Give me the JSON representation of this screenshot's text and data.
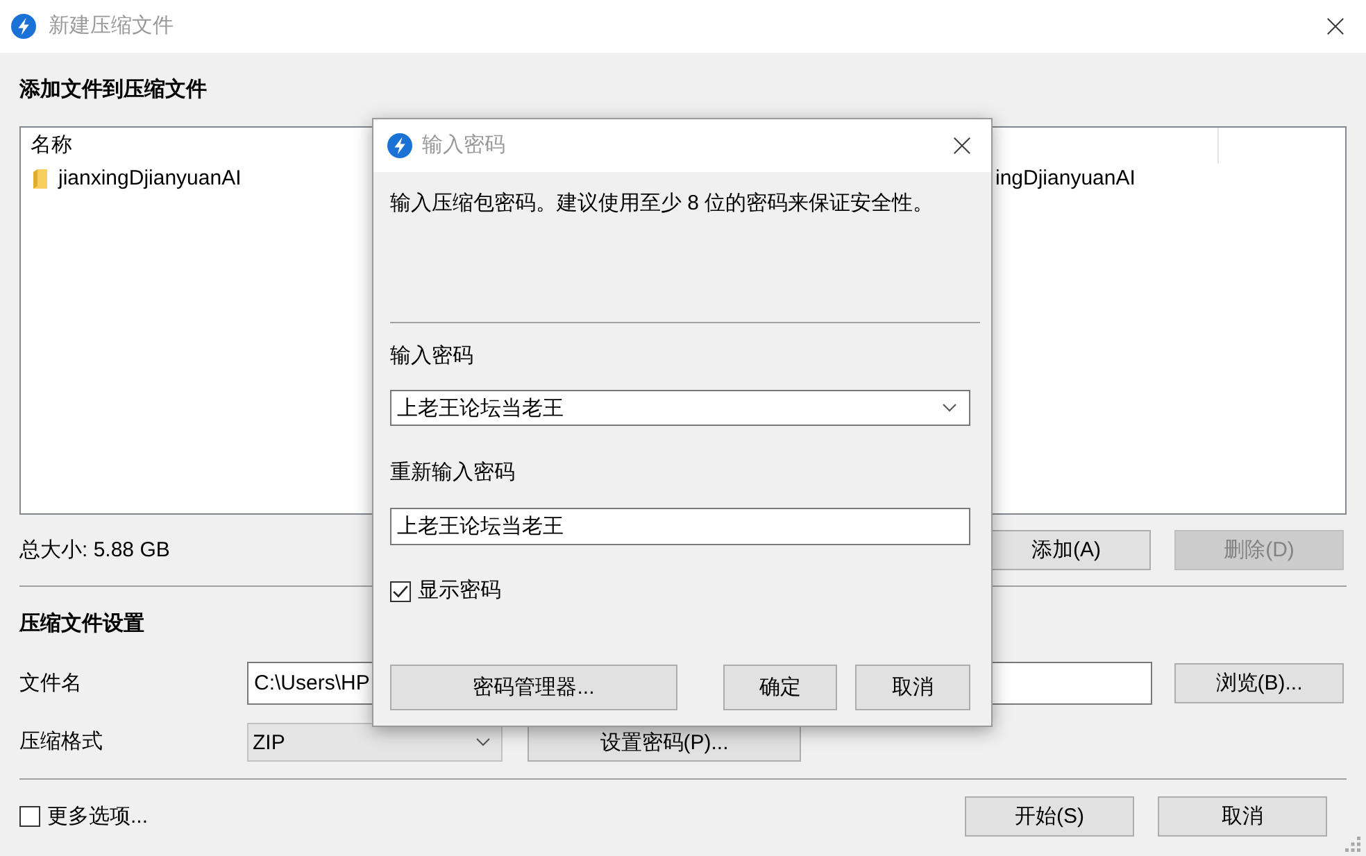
{
  "window": {
    "title": "新建压缩文件"
  },
  "files": {
    "heading": "添加文件到压缩文件",
    "table": {
      "columns": [
        "名称"
      ],
      "rows": [
        [
          "jianxingDjianyuanAI",
          "ingDjianyuanAI"
        ]
      ]
    },
    "total_size": "总大小: 5.88 GB",
    "buttons": [
      {
        "label": "添加(A)",
        "disabled": false
      },
      {
        "label": "删除(D)",
        "disabled": true
      }
    ]
  },
  "settings": {
    "heading": "压缩文件设置",
    "file_name": {
      "label": "文件名",
      "value": "C:\\Users\\HP"
    },
    "browse_button": "浏览(B)...",
    "format": {
      "label": "压缩格式",
      "value": "ZIP"
    },
    "password_button": "设置密码(P)..."
  },
  "footer": {
    "more_options": {
      "label": "更多选项...",
      "checked": false
    },
    "buttons": [
      "开始(S)",
      "取消"
    ]
  },
  "dialog": {
    "title": "输入密码",
    "description": "输入压缩包密码。建议使用至少 8 位的密码来保证安全性。",
    "password": {
      "label": "输入密码",
      "value": "上老王论坛当老王"
    },
    "confirm_password": {
      "label": "重新输入密码",
      "value": "上老王论坛当老王"
    },
    "show_password": {
      "label": "显示密码",
      "checked": true
    },
    "buttons": [
      "密码管理器...",
      "确定",
      "取消"
    ]
  }
}
